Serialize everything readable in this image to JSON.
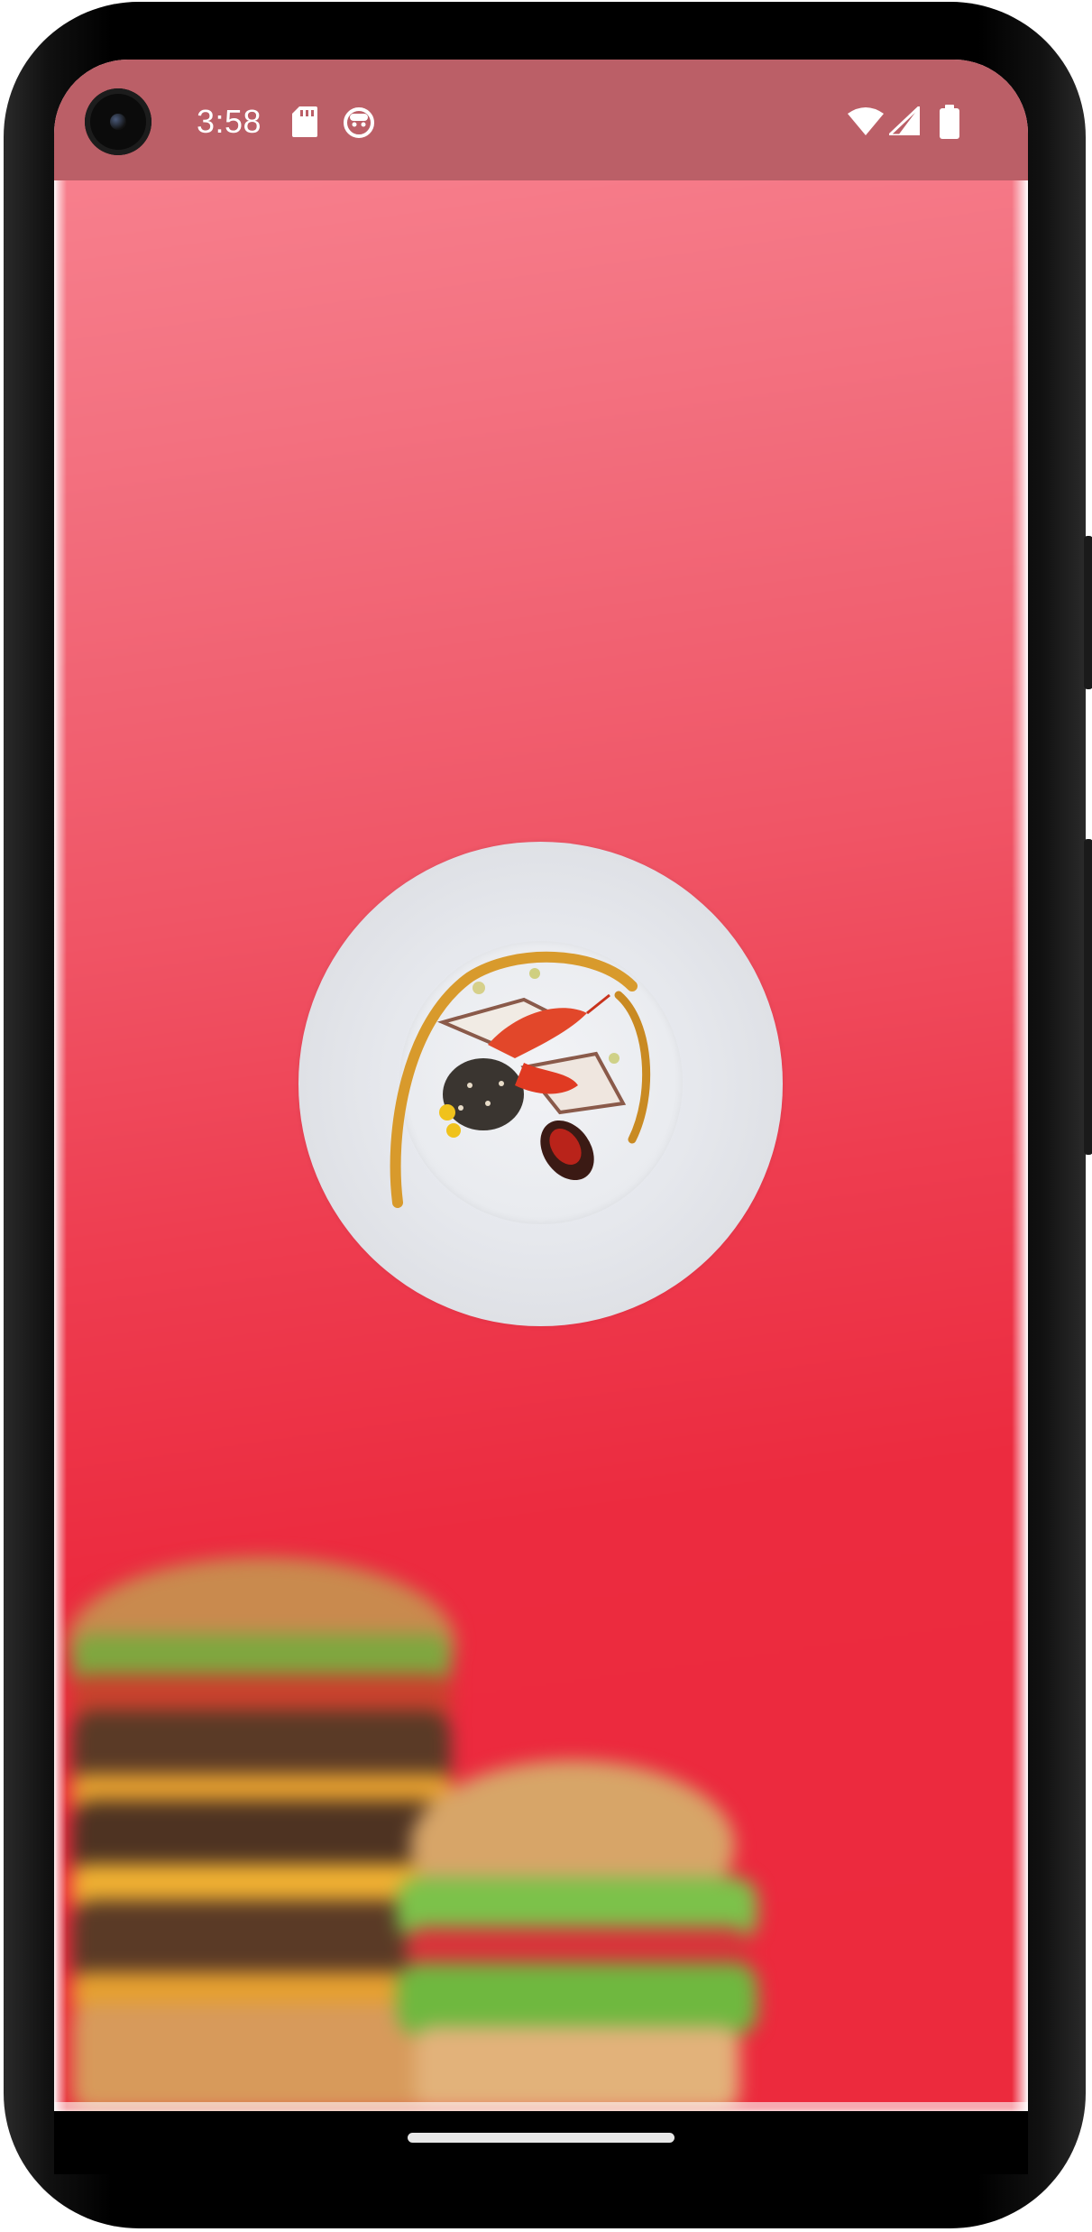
{
  "status_bar": {
    "time": "3:58",
    "icons": [
      "sd-card-icon",
      "face-icon",
      "wifi-icon",
      "cell-signal-icon",
      "battery-icon"
    ]
  },
  "splash": {
    "logo_image": "plated-dish-with-prawn",
    "background_image": "blurred-burgers",
    "background_colors": [
      "#f98592",
      "#ec2a3d"
    ]
  },
  "system": {
    "nav_handle": "home-gesture-bar"
  }
}
